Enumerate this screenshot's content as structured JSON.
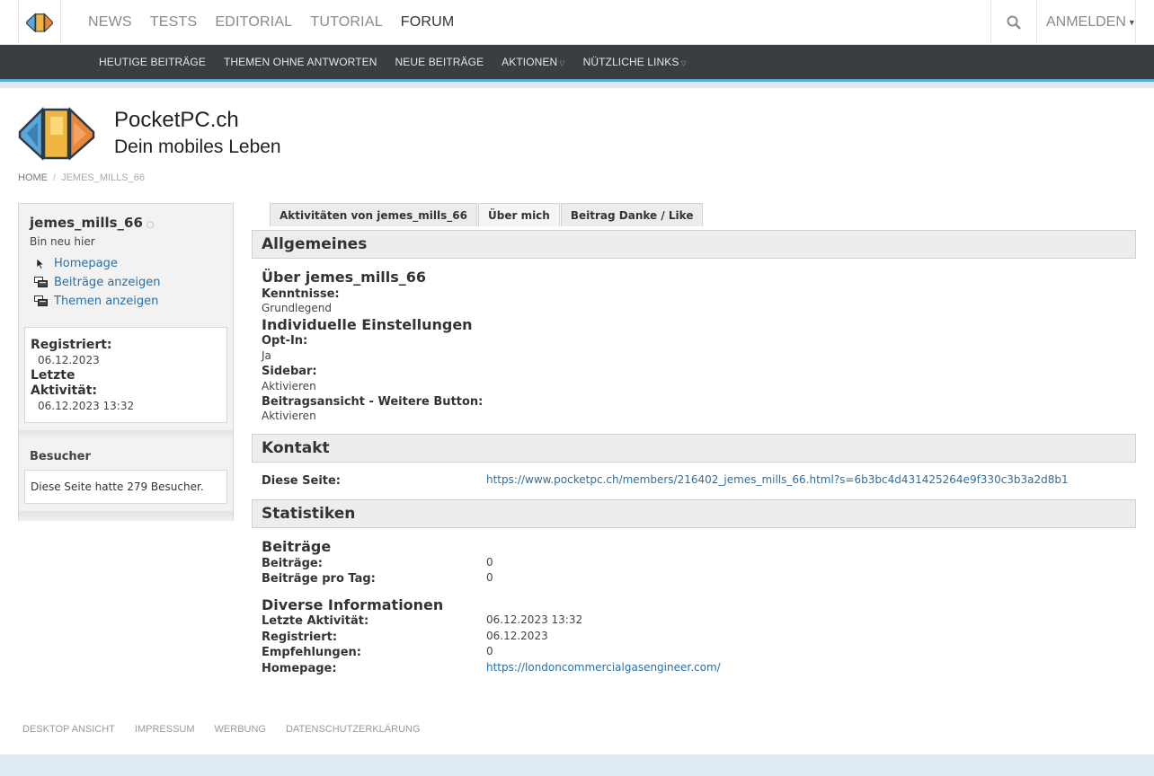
{
  "topnav": {
    "menu": [
      {
        "label": "NEWS",
        "active": false
      },
      {
        "label": "TESTS",
        "active": false
      },
      {
        "label": "EDITORIAL",
        "active": false
      },
      {
        "label": "TUTORIAL",
        "active": false
      },
      {
        "label": "FORUM",
        "active": true
      }
    ],
    "login_label": "ANMELDEN"
  },
  "subnav": {
    "items": [
      {
        "label": "HEUTIGE BEITRÄGE",
        "dropdown": false
      },
      {
        "label": "THEMEN OHNE ANTWORTEN",
        "dropdown": false
      },
      {
        "label": "NEUE BEITRÄGE",
        "dropdown": false
      },
      {
        "label": "AKTIONEN",
        "dropdown": true
      },
      {
        "label": "NÜTZLICHE LINKS",
        "dropdown": true
      }
    ]
  },
  "site": {
    "name": "PocketPC.ch",
    "tagline": "Dein mobiles Leben"
  },
  "breadcrumb": {
    "home": "HOME",
    "current": "JEMES_MILLS_66"
  },
  "sidebar": {
    "username": "jemes_mills_66",
    "user_title": "Bin neu hier",
    "links": {
      "homepage": "Homepage",
      "posts": "Beiträge anzeigen",
      "threads": "Themen anzeigen"
    },
    "registered_label": "Registriert:",
    "registered_value": "06.12.2023",
    "last_activity_label_1": "Letzte",
    "last_activity_label_2": "Aktivität:",
    "last_activity_value": "06.12.2023 13:32",
    "visitors_title": "Besucher",
    "visitors_text": "Diese Seite hatte 279 Besucher."
  },
  "tabs": [
    {
      "label": "Aktivitäten von jemes_mills_66",
      "selected": false
    },
    {
      "label": "Über mich",
      "selected": true
    },
    {
      "label": "Beitrag Danke / Like",
      "selected": false
    }
  ],
  "general": {
    "title": "Allgemeines",
    "about_heading": "Über jemes_mills_66",
    "skills_label": "Kenntnisse:",
    "skills_value": "Grundlegend",
    "settings_heading": "Individuelle Einstellungen",
    "optin_label": "Opt-In:",
    "optin_value": "Ja",
    "sidebar_label": "Sidebar:",
    "sidebar_value": "Aktivieren",
    "postview_label": "Beitragsansicht - Weitere Button:",
    "postview_value": "Aktivieren"
  },
  "contact": {
    "title": "Kontakt",
    "page_label": "Diese Seite:",
    "page_url": "https://www.pocketpc.ch/members/216402_jemes_mills_66.html?s=6b3bc4d431425264e9f330c3b3a2d8b1"
  },
  "stats": {
    "title": "Statistiken",
    "posts_heading": "Beiträge",
    "posts_label": "Beiträge:",
    "posts_value": "0",
    "posts_per_day_label": "Beiträge pro Tag:",
    "posts_per_day_value": "0",
    "misc_heading": "Diverse Informationen",
    "last_activity_label": "Letzte Aktivität:",
    "last_activity_value": "06.12.2023 13:32",
    "registered_label": "Registriert:",
    "registered_value": "06.12.2023",
    "referrals_label": "Empfehlungen:",
    "referrals_value": "0",
    "homepage_label": "Homepage:",
    "homepage_value": "https://londoncommercialgasengineer.com/"
  },
  "footer": {
    "links": [
      "DESKTOP ANSICHT",
      "IMPRESSUM",
      "WERBUNG",
      "DATENSCHUTZERKLÄRUNG"
    ]
  },
  "colors": {
    "link": "#2b6fa6",
    "subnav_bg": "#3b3e40",
    "accent_blue": "#5aa7dc"
  }
}
